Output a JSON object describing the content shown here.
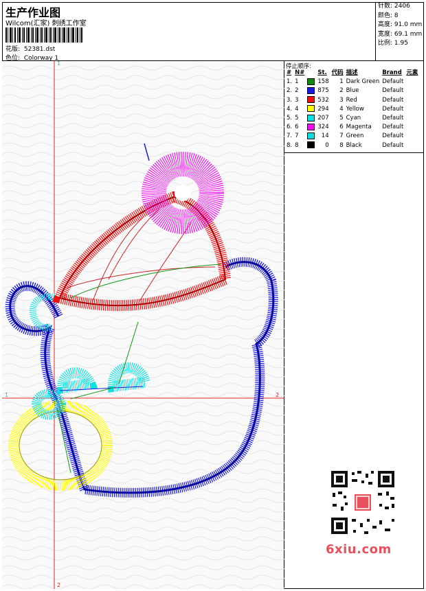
{
  "header": {
    "title": "生产作业图",
    "company": "Wilcom(汇家) 刺绣工作室",
    "pattern_label": "花版:",
    "pattern_value": "52381.dst",
    "colorway_label": "色位:",
    "colorway_value": "Colorway 1"
  },
  "stats": {
    "stitches": "针数: 2406",
    "colors": "颜色: 8",
    "height": "高度: 91.0 mm",
    "width": "宽度: 69.1 mm",
    "scale": "比例: 1.95"
  },
  "canvas": {
    "marker_top": "1",
    "marker_left": "1",
    "marker_right": "2",
    "marker_bottom": "2"
  },
  "stop_sequence": {
    "heading": "停止顺序:",
    "columns": [
      "#",
      "N#",
      "St.",
      "代码",
      "描述",
      "Brand",
      "元素"
    ],
    "rows": [
      {
        "idx": "1.",
        "n": "1",
        "color": "#0f8a0f",
        "st": "158",
        "code": "1",
        "desc": "Dark Green",
        "brand": "Default"
      },
      {
        "idx": "2.",
        "n": "2",
        "color": "#1a1adf",
        "st": "875",
        "code": "2",
        "desc": "Blue",
        "brand": "Default"
      },
      {
        "idx": "3.",
        "n": "3",
        "color": "#ee1111",
        "st": "532",
        "code": "3",
        "desc": "Red",
        "brand": "Default"
      },
      {
        "idx": "4.",
        "n": "4",
        "color": "#ffff00",
        "st": "294",
        "code": "4",
        "desc": "Yellow",
        "brand": "Default"
      },
      {
        "idx": "5.",
        "n": "5",
        "color": "#11e0e0",
        "st": "207",
        "code": "5",
        "desc": "Cyan",
        "brand": "Default"
      },
      {
        "idx": "6.",
        "n": "6",
        "color": "#ee11ee",
        "st": "324",
        "code": "6",
        "desc": "Magenta",
        "brand": "Default"
      },
      {
        "idx": "7.",
        "n": "7",
        "color": "#11dddd",
        "st": "14",
        "code": "7",
        "desc": "Green",
        "brand": "Default"
      },
      {
        "idx": "8.",
        "n": "8",
        "color": "#000000",
        "st": "0",
        "code": "8",
        "desc": "Black",
        "brand": "Default"
      }
    ]
  },
  "watermark": {
    "site": "6xiu.com",
    "qr_icon": "qr-code-icon"
  }
}
